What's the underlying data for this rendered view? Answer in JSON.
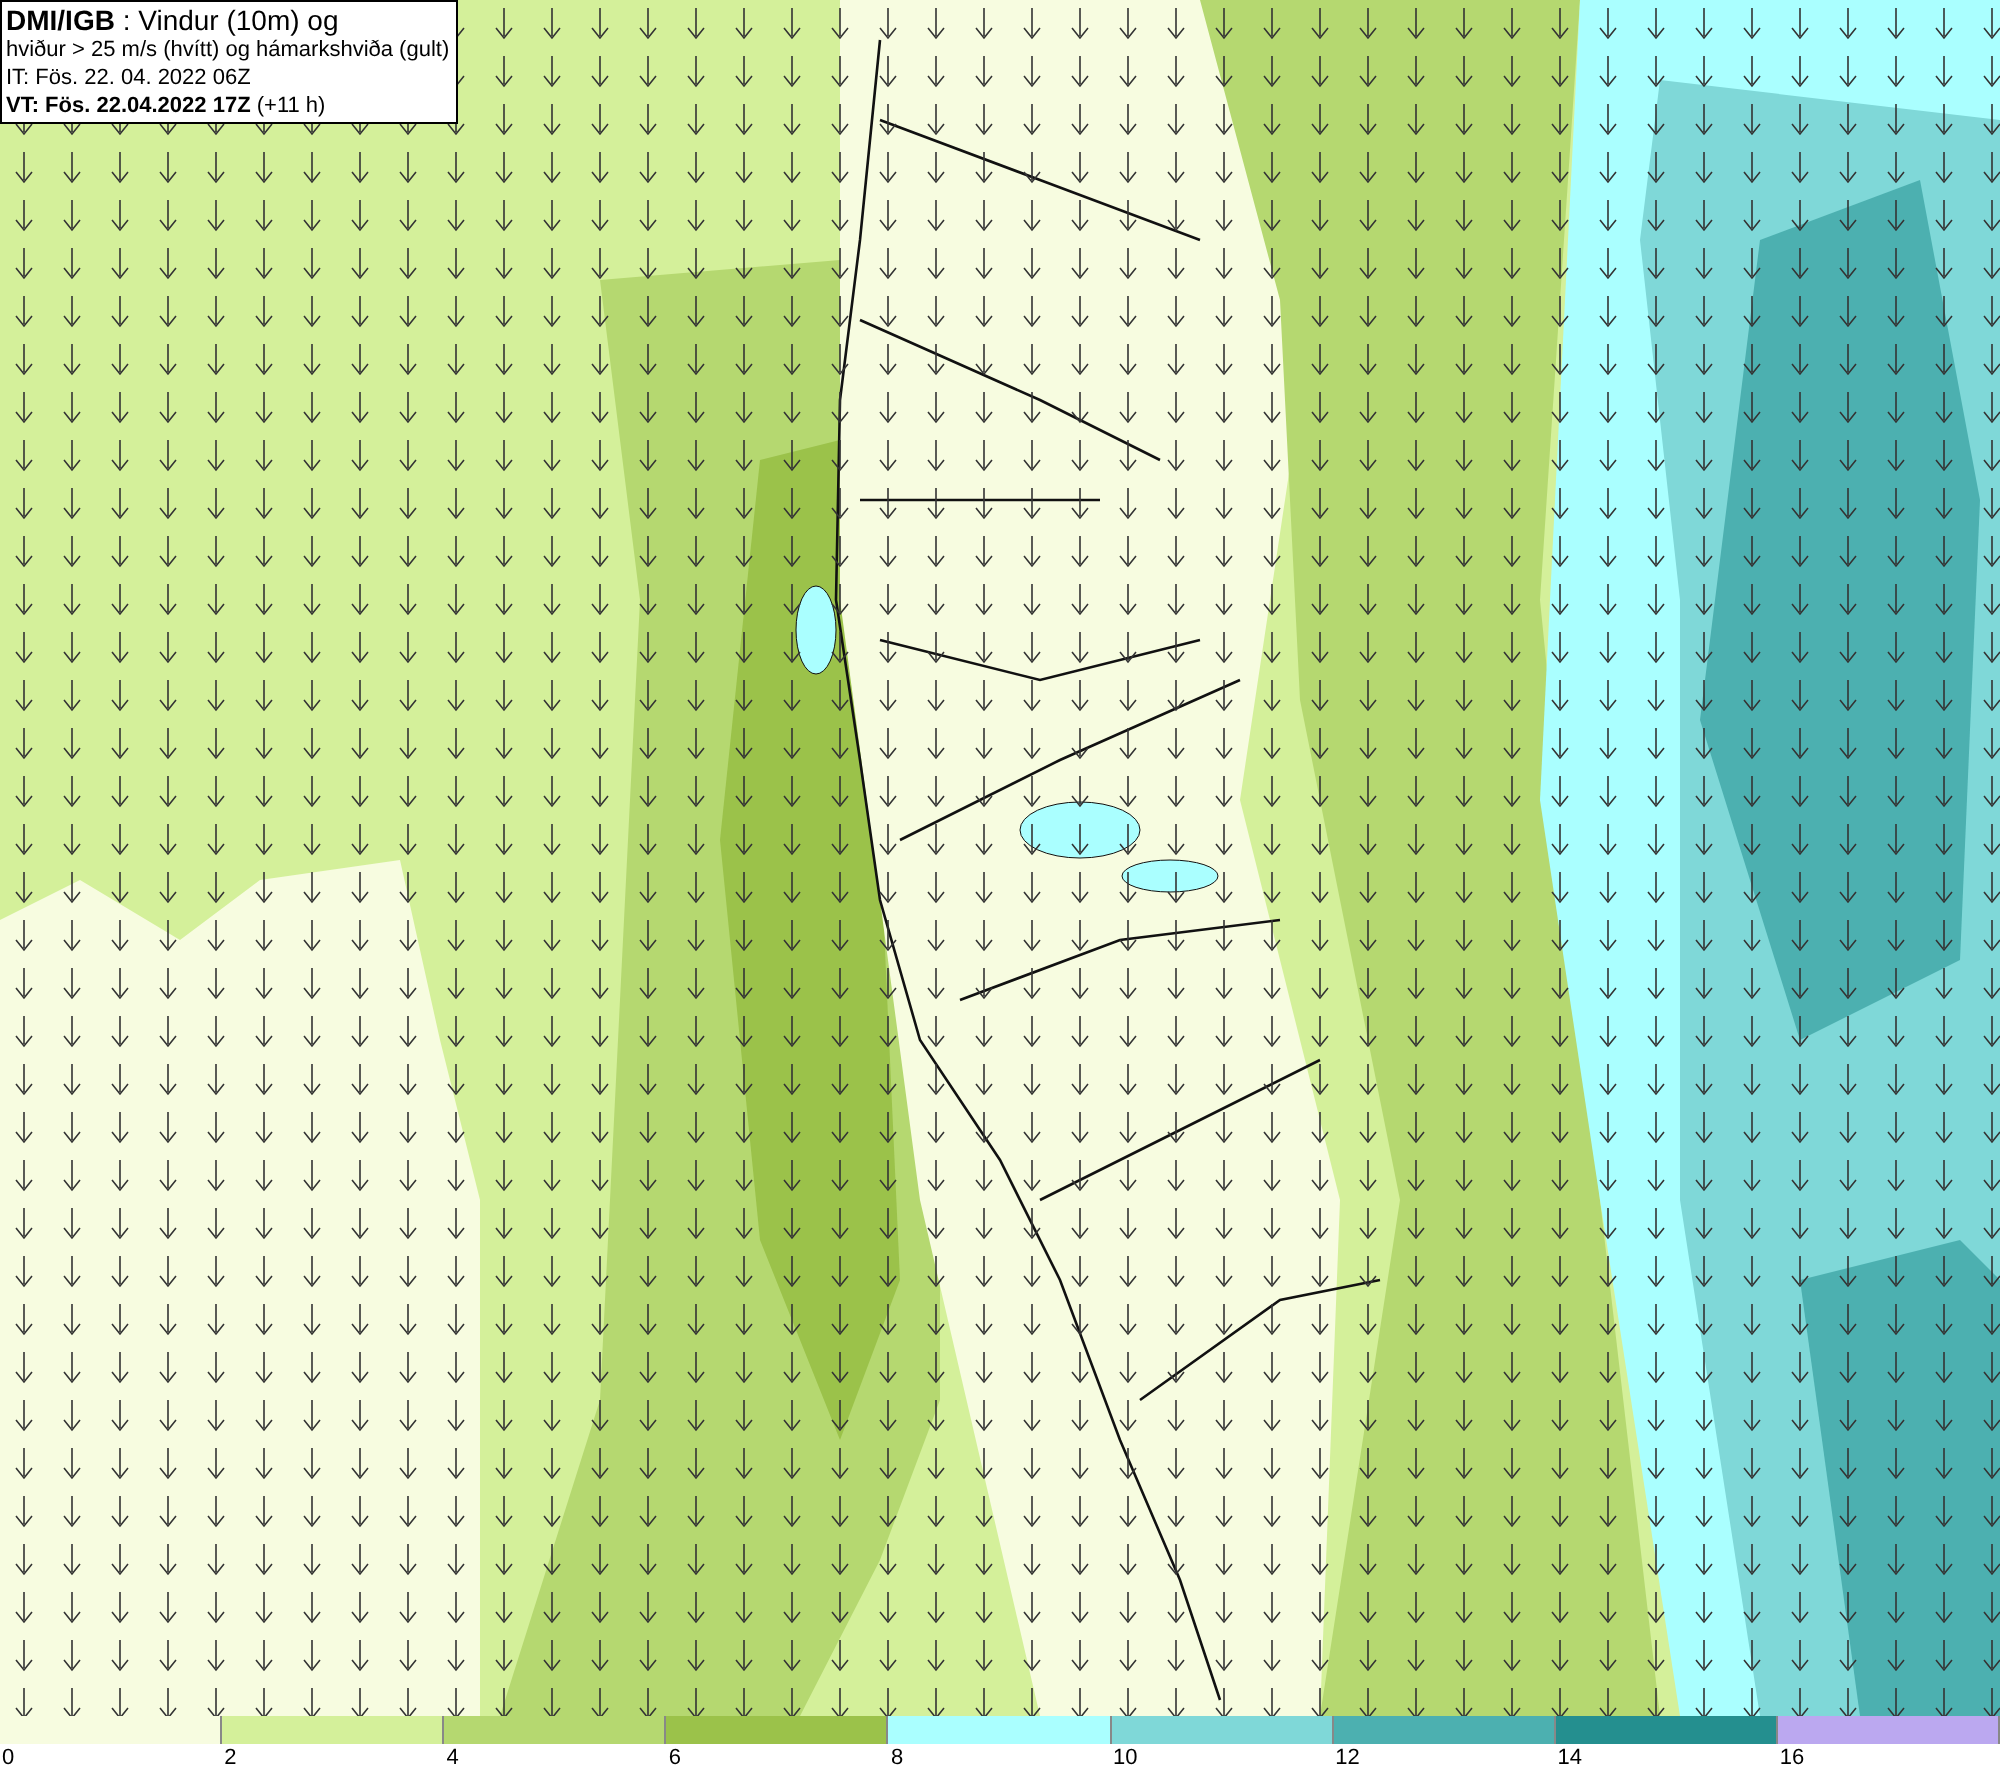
{
  "title_box": {
    "lines": [
      "**DMI/IGB** : Vindur (10m) og",
      "hviður > 25 m/s (hvítt) og hámarkshviða (gult)",
      "IT: Fös. 22. 04. 2022 06Z",
      "**VT: Fös. 22.04.2022 17Z** (+11 h)"
    ]
  },
  "legend": [
    {
      "label": "0",
      "color": "#f7fce0"
    },
    {
      "label": "2",
      "color": "#d4f09a"
    },
    {
      "label": "4",
      "color": "#b5d870"
    },
    {
      "label": "6",
      "color": "#9bc24a"
    },
    {
      "label": "8",
      "color": "#aaffff"
    },
    {
      "label": "10",
      "color": "#7fd8d8"
    },
    {
      "label": "12",
      "color": "#4cb0b0"
    },
    {
      "label": "14",
      "color": "#248f8f"
    },
    {
      "label": "16",
      "color": "#bba8f0"
    }
  ]
}
